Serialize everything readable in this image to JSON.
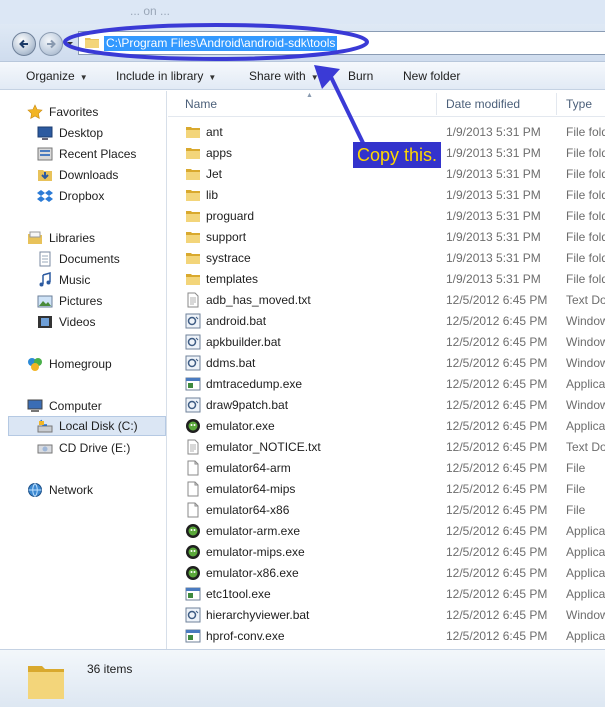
{
  "background_text": "... on ... ",
  "navigation": {
    "address_path": "C:\\Program Files\\Android\\android-sdk\\tools"
  },
  "toolbar": {
    "organize": "Organize",
    "include_in_library": "Include in library",
    "share_with": "Share with",
    "burn": "Burn",
    "new_folder": "New folder"
  },
  "sidebar": {
    "favorites": "Favorites",
    "desktop": "Desktop",
    "recent_places": "Recent Places",
    "downloads": "Downloads",
    "dropbox": "Dropbox",
    "libraries": "Libraries",
    "documents": "Documents",
    "music": "Music",
    "pictures": "Pictures",
    "videos": "Videos",
    "homegroup": "Homegroup",
    "computer": "Computer",
    "local_disk": "Local Disk (C:)",
    "cd_drive": "CD Drive (E:)",
    "network": "Network"
  },
  "columns": {
    "name": "Name",
    "date_modified": "Date modified",
    "type": "Type"
  },
  "files": [
    {
      "name": "ant",
      "date": "1/9/2013 5:31 PM",
      "type": "File folder",
      "icon": "folder-icon"
    },
    {
      "name": "apps",
      "date": "1/9/2013 5:31 PM",
      "type": "File folder",
      "icon": "folder-icon"
    },
    {
      "name": "Jet",
      "date": "1/9/2013 5:31 PM",
      "type": "File folder",
      "icon": "folder-icon"
    },
    {
      "name": "lib",
      "date": "1/9/2013 5:31 PM",
      "type": "File folder",
      "icon": "folder-icon"
    },
    {
      "name": "proguard",
      "date": "1/9/2013 5:31 PM",
      "type": "File folder",
      "icon": "folder-icon"
    },
    {
      "name": "support",
      "date": "1/9/2013 5:31 PM",
      "type": "File folder",
      "icon": "folder-icon"
    },
    {
      "name": "systrace",
      "date": "1/9/2013 5:31 PM",
      "type": "File folder",
      "icon": "folder-icon"
    },
    {
      "name": "templates",
      "date": "1/9/2013 5:31 PM",
      "type": "File folder",
      "icon": "folder-icon"
    },
    {
      "name": "adb_has_moved.txt",
      "date": "12/5/2012 6:45 PM",
      "type": "Text Document",
      "icon": "text-file-icon"
    },
    {
      "name": "android.bat",
      "date": "12/5/2012 6:45 PM",
      "type": "Windows Batch File",
      "icon": "batch-file-icon"
    },
    {
      "name": "apkbuilder.bat",
      "date": "12/5/2012 6:45 PM",
      "type": "Windows Batch File",
      "icon": "batch-file-icon"
    },
    {
      "name": "ddms.bat",
      "date": "12/5/2012 6:45 PM",
      "type": "Windows Batch File",
      "icon": "batch-file-icon"
    },
    {
      "name": "dmtracedump.exe",
      "date": "12/5/2012 6:45 PM",
      "type": "Application",
      "icon": "application-icon"
    },
    {
      "name": "draw9patch.bat",
      "date": "12/5/2012 6:45 PM",
      "type": "Windows Batch File",
      "icon": "batch-file-icon"
    },
    {
      "name": "emulator.exe",
      "date": "12/5/2012 6:45 PM",
      "type": "Application",
      "icon": "emulator-icon"
    },
    {
      "name": "emulator_NOTICE.txt",
      "date": "12/5/2012 6:45 PM",
      "type": "Text Document",
      "icon": "text-file-icon"
    },
    {
      "name": "emulator64-arm",
      "date": "12/5/2012 6:45 PM",
      "type": "File",
      "icon": "blank-file-icon"
    },
    {
      "name": "emulator64-mips",
      "date": "12/5/2012 6:45 PM",
      "type": "File",
      "icon": "blank-file-icon"
    },
    {
      "name": "emulator64-x86",
      "date": "12/5/2012 6:45 PM",
      "type": "File",
      "icon": "blank-file-icon"
    },
    {
      "name": "emulator-arm.exe",
      "date": "12/5/2012 6:45 PM",
      "type": "Application",
      "icon": "emulator-icon"
    },
    {
      "name": "emulator-mips.exe",
      "date": "12/5/2012 6:45 PM",
      "type": "Application",
      "icon": "emulator-icon"
    },
    {
      "name": "emulator-x86.exe",
      "date": "12/5/2012 6:45 PM",
      "type": "Application",
      "icon": "emulator-icon"
    },
    {
      "name": "etc1tool.exe",
      "date": "12/5/2012 6:45 PM",
      "type": "Application",
      "icon": "application-icon"
    },
    {
      "name": "hierarchyviewer.bat",
      "date": "12/5/2012 6:45 PM",
      "type": "Windows Batch File",
      "icon": "batch-file-icon"
    },
    {
      "name": "hprof-conv.exe",
      "date": "12/5/2012 6:45 PM",
      "type": "Application",
      "icon": "application-icon"
    }
  ],
  "annotation": {
    "text": "Copy this.",
    "background_color": "#3333cc",
    "text_color": "#ffd700"
  },
  "details": {
    "item_count": "36 items"
  }
}
